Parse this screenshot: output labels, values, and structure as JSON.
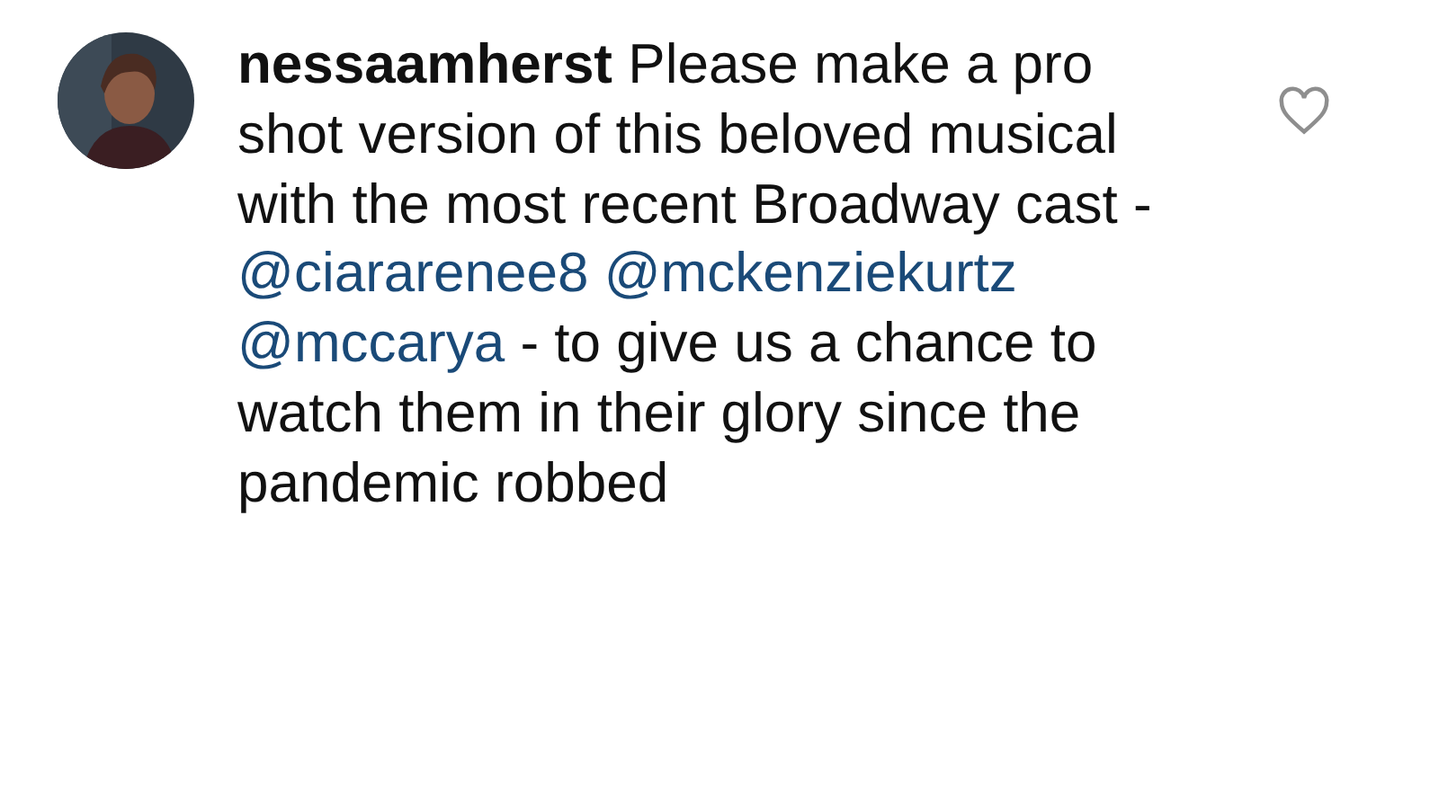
{
  "comment": {
    "username": "nessaamherst",
    "parts": [
      {
        "kind": "text",
        "text": "Please make a pro shot version of this beloved musical with the most recent Broadway cast -"
      },
      {
        "kind": "mention",
        "text": "@ciararenee8"
      },
      {
        "kind": "mention",
        "text": "@mckenziekurtz"
      },
      {
        "kind": "mention",
        "text": "@mccarya"
      },
      {
        "kind": "text",
        "text": "- to give us a chance to watch them in their glory since the pandemic robbed"
      }
    ],
    "liked": false
  }
}
